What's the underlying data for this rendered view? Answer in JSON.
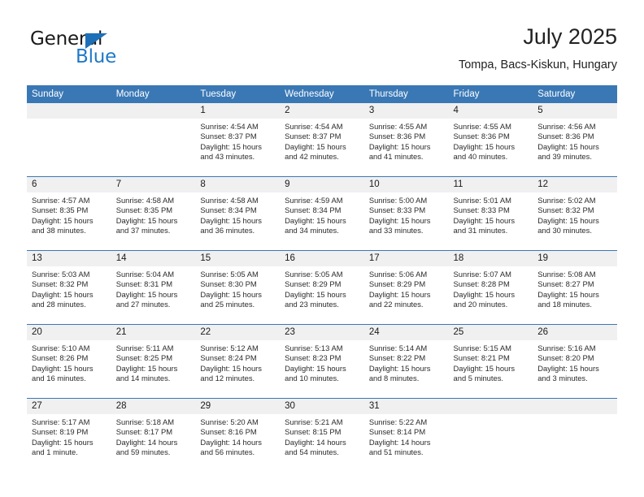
{
  "brand": {
    "name_part1": "General",
    "name_part2": "Blue",
    "accent_color": "#2079c7",
    "triangle_color": "#1d70b8"
  },
  "header": {
    "title": "July 2025",
    "subtitle": "Tompa, Bacs-Kiskun, Hungary"
  },
  "calendar": {
    "header_bg": "#3a78b5",
    "daynum_bg": "#f0f0f0",
    "weekdays": [
      "Sunday",
      "Monday",
      "Tuesday",
      "Wednesday",
      "Thursday",
      "Friday",
      "Saturday"
    ],
    "weeks": [
      [
        {
          "day": "",
          "sunrise": "",
          "sunset": "",
          "daylight": ""
        },
        {
          "day": "",
          "sunrise": "",
          "sunset": "",
          "daylight": ""
        },
        {
          "day": "1",
          "sunrise": "Sunrise: 4:54 AM",
          "sunset": "Sunset: 8:37 PM",
          "daylight": "Daylight: 15 hours and 43 minutes."
        },
        {
          "day": "2",
          "sunrise": "Sunrise: 4:54 AM",
          "sunset": "Sunset: 8:37 PM",
          "daylight": "Daylight: 15 hours and 42 minutes."
        },
        {
          "day": "3",
          "sunrise": "Sunrise: 4:55 AM",
          "sunset": "Sunset: 8:36 PM",
          "daylight": "Daylight: 15 hours and 41 minutes."
        },
        {
          "day": "4",
          "sunrise": "Sunrise: 4:55 AM",
          "sunset": "Sunset: 8:36 PM",
          "daylight": "Daylight: 15 hours and 40 minutes."
        },
        {
          "day": "5",
          "sunrise": "Sunrise: 4:56 AM",
          "sunset": "Sunset: 8:36 PM",
          "daylight": "Daylight: 15 hours and 39 minutes."
        }
      ],
      [
        {
          "day": "6",
          "sunrise": "Sunrise: 4:57 AM",
          "sunset": "Sunset: 8:35 PM",
          "daylight": "Daylight: 15 hours and 38 minutes."
        },
        {
          "day": "7",
          "sunrise": "Sunrise: 4:58 AM",
          "sunset": "Sunset: 8:35 PM",
          "daylight": "Daylight: 15 hours and 37 minutes."
        },
        {
          "day": "8",
          "sunrise": "Sunrise: 4:58 AM",
          "sunset": "Sunset: 8:34 PM",
          "daylight": "Daylight: 15 hours and 36 minutes."
        },
        {
          "day": "9",
          "sunrise": "Sunrise: 4:59 AM",
          "sunset": "Sunset: 8:34 PM",
          "daylight": "Daylight: 15 hours and 34 minutes."
        },
        {
          "day": "10",
          "sunrise": "Sunrise: 5:00 AM",
          "sunset": "Sunset: 8:33 PM",
          "daylight": "Daylight: 15 hours and 33 minutes."
        },
        {
          "day": "11",
          "sunrise": "Sunrise: 5:01 AM",
          "sunset": "Sunset: 8:33 PM",
          "daylight": "Daylight: 15 hours and 31 minutes."
        },
        {
          "day": "12",
          "sunrise": "Sunrise: 5:02 AM",
          "sunset": "Sunset: 8:32 PM",
          "daylight": "Daylight: 15 hours and 30 minutes."
        }
      ],
      [
        {
          "day": "13",
          "sunrise": "Sunrise: 5:03 AM",
          "sunset": "Sunset: 8:32 PM",
          "daylight": "Daylight: 15 hours and 28 minutes."
        },
        {
          "day": "14",
          "sunrise": "Sunrise: 5:04 AM",
          "sunset": "Sunset: 8:31 PM",
          "daylight": "Daylight: 15 hours and 27 minutes."
        },
        {
          "day": "15",
          "sunrise": "Sunrise: 5:05 AM",
          "sunset": "Sunset: 8:30 PM",
          "daylight": "Daylight: 15 hours and 25 minutes."
        },
        {
          "day": "16",
          "sunrise": "Sunrise: 5:05 AM",
          "sunset": "Sunset: 8:29 PM",
          "daylight": "Daylight: 15 hours and 23 minutes."
        },
        {
          "day": "17",
          "sunrise": "Sunrise: 5:06 AM",
          "sunset": "Sunset: 8:29 PM",
          "daylight": "Daylight: 15 hours and 22 minutes."
        },
        {
          "day": "18",
          "sunrise": "Sunrise: 5:07 AM",
          "sunset": "Sunset: 8:28 PM",
          "daylight": "Daylight: 15 hours and 20 minutes."
        },
        {
          "day": "19",
          "sunrise": "Sunrise: 5:08 AM",
          "sunset": "Sunset: 8:27 PM",
          "daylight": "Daylight: 15 hours and 18 minutes."
        }
      ],
      [
        {
          "day": "20",
          "sunrise": "Sunrise: 5:10 AM",
          "sunset": "Sunset: 8:26 PM",
          "daylight": "Daylight: 15 hours and 16 minutes."
        },
        {
          "day": "21",
          "sunrise": "Sunrise: 5:11 AM",
          "sunset": "Sunset: 8:25 PM",
          "daylight": "Daylight: 15 hours and 14 minutes."
        },
        {
          "day": "22",
          "sunrise": "Sunrise: 5:12 AM",
          "sunset": "Sunset: 8:24 PM",
          "daylight": "Daylight: 15 hours and 12 minutes."
        },
        {
          "day": "23",
          "sunrise": "Sunrise: 5:13 AM",
          "sunset": "Sunset: 8:23 PM",
          "daylight": "Daylight: 15 hours and 10 minutes."
        },
        {
          "day": "24",
          "sunrise": "Sunrise: 5:14 AM",
          "sunset": "Sunset: 8:22 PM",
          "daylight": "Daylight: 15 hours and 8 minutes."
        },
        {
          "day": "25",
          "sunrise": "Sunrise: 5:15 AM",
          "sunset": "Sunset: 8:21 PM",
          "daylight": "Daylight: 15 hours and 5 minutes."
        },
        {
          "day": "26",
          "sunrise": "Sunrise: 5:16 AM",
          "sunset": "Sunset: 8:20 PM",
          "daylight": "Daylight: 15 hours and 3 minutes."
        }
      ],
      [
        {
          "day": "27",
          "sunrise": "Sunrise: 5:17 AM",
          "sunset": "Sunset: 8:19 PM",
          "daylight": "Daylight: 15 hours and 1 minute."
        },
        {
          "day": "28",
          "sunrise": "Sunrise: 5:18 AM",
          "sunset": "Sunset: 8:17 PM",
          "daylight": "Daylight: 14 hours and 59 minutes."
        },
        {
          "day": "29",
          "sunrise": "Sunrise: 5:20 AM",
          "sunset": "Sunset: 8:16 PM",
          "daylight": "Daylight: 14 hours and 56 minutes."
        },
        {
          "day": "30",
          "sunrise": "Sunrise: 5:21 AM",
          "sunset": "Sunset: 8:15 PM",
          "daylight": "Daylight: 14 hours and 54 minutes."
        },
        {
          "day": "31",
          "sunrise": "Sunrise: 5:22 AM",
          "sunset": "Sunset: 8:14 PM",
          "daylight": "Daylight: 14 hours and 51 minutes."
        },
        {
          "day": "",
          "sunrise": "",
          "sunset": "",
          "daylight": ""
        },
        {
          "day": "",
          "sunrise": "",
          "sunset": "",
          "daylight": ""
        }
      ]
    ]
  }
}
